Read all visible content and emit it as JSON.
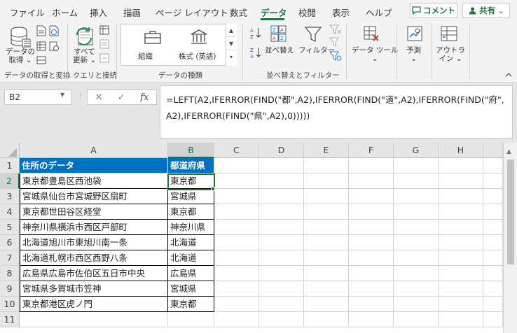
{
  "tabs": [
    "ファイル",
    "ホーム",
    "挿入",
    "描画",
    "ページ レイアウト",
    "数式",
    "データ",
    "校閲",
    "表示",
    "ヘルプ"
  ],
  "active_tab": "データ",
  "comment_button": "コメント",
  "share_button": "共有",
  "ribbon": {
    "get_data": "データの取得",
    "get_data_line1": "データの",
    "get_data_line2": "取得 ⌄",
    "refresh_line1": "すべて",
    "refresh_line2": "更新 ⌄",
    "group_get_transform": "データの取得と変換",
    "group_queries": "クエリと接続",
    "datatype_org": "組織",
    "datatype_stocks": "株式 (英語)",
    "group_datatypes": "データの種類",
    "sort": "並べ替え",
    "filter": "フィルター",
    "group_sort_filter": "並べ替えとフィルター",
    "data_tools": "データ ツール",
    "forecast": "予測",
    "outline_line1": "アウトラ",
    "outline_line2": "イン ⌄",
    "chevron": "⌄"
  },
  "formula_bar": {
    "name_box": "B2",
    "cancel": "✕",
    "enter": "✓",
    "fx": "fx",
    "formula": "=LEFT(A2,IFERROR(FIND(\"都\",A2),IFERROR(FIND(\"道\",A2),IFERROR(FIND(\"府\",A2),IFERROR(FIND(\"県\",A2),0)))))"
  },
  "columns": [
    "A",
    "B",
    "C",
    "D",
    "E",
    "F",
    "G",
    "H"
  ],
  "rows": [
    "1",
    "2",
    "3",
    "4",
    "5",
    "6",
    "7",
    "8",
    "9",
    "10",
    "11"
  ],
  "table": {
    "header_a": "住所のデータ",
    "header_b": "都道府県",
    "col_a": [
      "東京都豊島区西池袋",
      "宮城県仙台市宮城野区扇町",
      "東京都世田谷区経堂",
      "神奈川県横浜市西区戸部町",
      "北海道旭川市東旭川南一条",
      "北海道札幌市西区西野八条",
      "広島県広島市佐伯区五日市中央",
      "宮城県多賀城市笠神",
      "東京都港区虎ノ門"
    ],
    "col_b": [
      "東京都",
      "宮城県",
      "東京都",
      "神奈川県",
      "北海道",
      "北海道",
      "広島県",
      "宮城県",
      "東京都"
    ]
  },
  "colors": {
    "accent": "#217346",
    "table_header": "#0070c0"
  }
}
